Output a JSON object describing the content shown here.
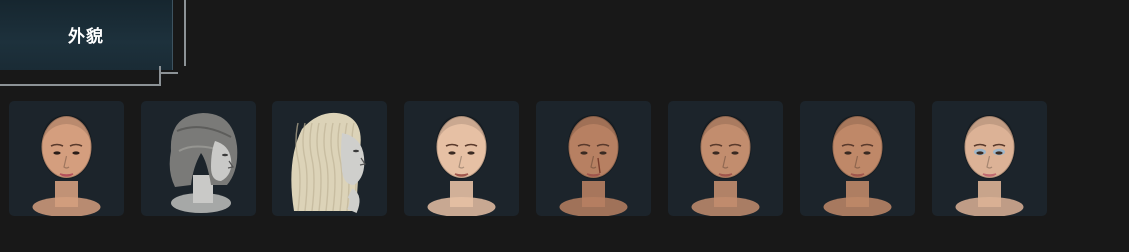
{
  "section": {
    "title": "外貌"
  },
  "appearance_presets": [
    {
      "id": "preset-1",
      "hair": "bald",
      "skin": "#d49e7e",
      "view": "front",
      "makeup": "bold"
    },
    {
      "id": "preset-2",
      "hair": "bob",
      "hair_color": "#7a7a78",
      "skin": "#c9c9c7",
      "view": "side"
    },
    {
      "id": "preset-3",
      "hair": "long-crimped",
      "hair_color": "#dcd3b8",
      "skin": "#cfcfcc",
      "view": "side"
    },
    {
      "id": "preset-4",
      "hair": "shaved",
      "skin": "#e6c0a4",
      "view": "front"
    },
    {
      "id": "preset-5",
      "hair": "shaved",
      "skin": "#b78062",
      "view": "front",
      "detail": "scar"
    },
    {
      "id": "preset-6",
      "hair": "shaved",
      "skin": "#c28d6e",
      "view": "front"
    },
    {
      "id": "preset-7",
      "hair": "shaved",
      "skin": "#bf8868",
      "view": "front"
    },
    {
      "id": "preset-8",
      "hair": "shaved",
      "skin": "#dcb296",
      "view": "front",
      "makeup": "blue-eyeshadow"
    }
  ]
}
